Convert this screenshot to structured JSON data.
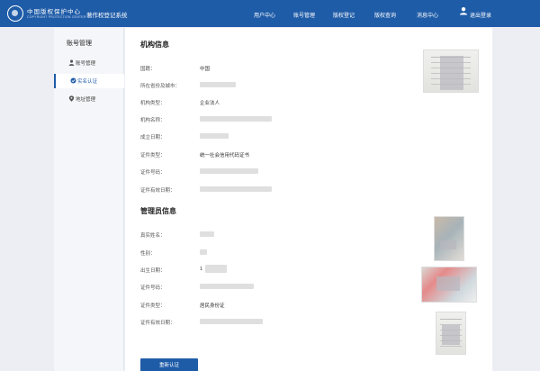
{
  "header": {
    "org_name": "中国版权保护中心",
    "org_subtitle": "COPYRIGHT PROTECTION CENTER",
    "system_name": "著作权登记系统",
    "nav": [
      "用户中心",
      "账号管理",
      "版权登记",
      "版权查询",
      "消息中心"
    ],
    "logout_label": "退出登录"
  },
  "sidebar": {
    "title": "账号管理",
    "items": [
      {
        "label": "账号管理",
        "icon": "user-icon"
      },
      {
        "label": "实名认证",
        "icon": "verify-icon"
      },
      {
        "label": "地址管理",
        "icon": "location-pin-icon"
      }
    ]
  },
  "org_info": {
    "title": "机构信息",
    "fields": [
      {
        "label": "国籍：",
        "value": "中国"
      },
      {
        "label": "所在省份及城市：",
        "value": ""
      },
      {
        "label": "机构类型：",
        "value": "企业法人"
      },
      {
        "label": "机构名称：",
        "value": ""
      },
      {
        "label": "成立日期：",
        "value": ""
      },
      {
        "label": "证件类型：",
        "value": "统一社会信用代码证书"
      },
      {
        "label": "证件号码：",
        "value": ""
      },
      {
        "label": "证件有效日期：",
        "value": ""
      }
    ]
  },
  "admin_info": {
    "title": "管理员信息",
    "fields": [
      {
        "label": "真实姓名：",
        "value": ""
      },
      {
        "label": "性别：",
        "value": ""
      },
      {
        "label": "出生日期：",
        "value": "1"
      },
      {
        "label": "证件号码：",
        "value": ""
      },
      {
        "label": "证件类型：",
        "value": "居民身份证"
      },
      {
        "label": "证件有效日期：",
        "value": ""
      }
    ]
  },
  "actions": {
    "reauth_label": "重新认证"
  },
  "colors": {
    "primary": "#1f5ca8",
    "background": "#eceef3",
    "sidebar": "#f4f6f9"
  }
}
